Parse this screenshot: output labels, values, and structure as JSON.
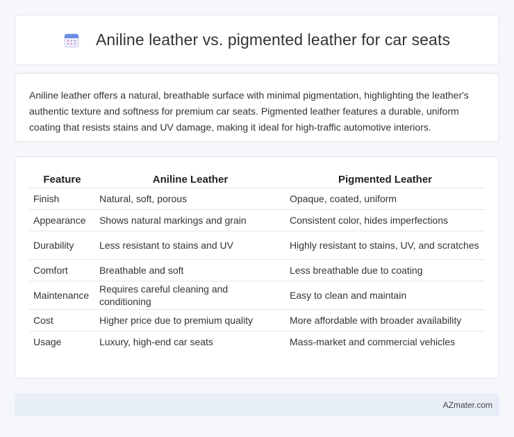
{
  "header": {
    "icon": "calendar-icon",
    "title": "Aniline leather vs. pigmented leather for car seats"
  },
  "intro": {
    "text": "Aniline leather offers a natural, breathable surface with minimal pigmentation, highlighting the leather's authentic texture and softness for premium car seats. Pigmented leather features a durable, uniform coating that resists stains and UV damage, making it ideal for high-traffic automotive interiors."
  },
  "table": {
    "headers": [
      "Feature",
      "Aniline Leather",
      "Pigmented Leather"
    ],
    "rows": [
      [
        "Finish",
        "Natural, soft, porous",
        "Opaque, coated, uniform"
      ],
      [
        "Appearance",
        "Shows natural markings and grain",
        "Consistent color, hides imperfections"
      ],
      [
        "Durability",
        "Less resistant to stains and UV",
        "Highly resistant to stains, UV, and scratches"
      ],
      [
        "Comfort",
        "Breathable and soft",
        "Less breathable due to coating"
      ],
      [
        "Maintenance",
        "Requires careful cleaning and conditioning",
        "Easy to clean and maintain"
      ],
      [
        "Cost",
        "Higher price due to premium quality",
        "More affordable with broader availability"
      ],
      [
        "Usage",
        "Luxury, high-end car seats",
        "Mass-market and commercial vehicles"
      ]
    ]
  },
  "footer": {
    "site": "AZmater.com"
  }
}
